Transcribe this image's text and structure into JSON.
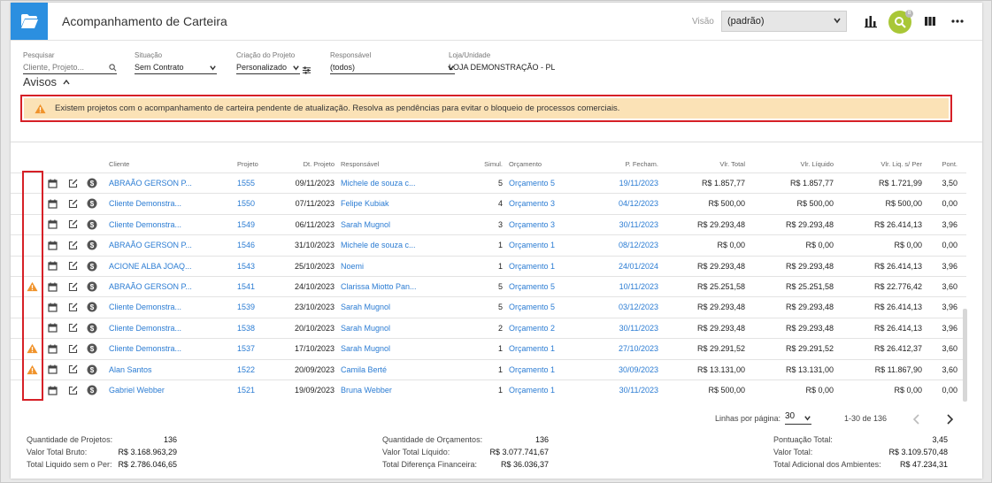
{
  "header": {
    "title": "Acompanhamento de Carteira",
    "visao_label": "Visão",
    "visao_value": "(padrão)",
    "search_badge": "8"
  },
  "filters": {
    "pesquisar": {
      "label": "Pesquisar",
      "placeholder": "Cliente, Projeto..."
    },
    "situacao": {
      "label": "Situação",
      "value": "Sem Contrato"
    },
    "criacao": {
      "label": "Criação do Projeto",
      "value": "Personalizado"
    },
    "responsavel": {
      "label": "Responsável",
      "value": "(todos)"
    },
    "loja": {
      "label": "Loja/Unidade",
      "value": "LOJA DEMONSTRAÇÃO - PL..."
    }
  },
  "avisos": {
    "title": "Avisos",
    "message": "Existem projetos com o acompanhamento de carteira pendente de atualização. Resolva as pendências para evitar o bloqueio de processos comerciais."
  },
  "table": {
    "headers": {
      "cliente": "Cliente",
      "projeto": "Projeto",
      "dt_projeto": "Dt. Projeto",
      "responsavel": "Responsável",
      "simul": "Simul.",
      "orcamento": "Orçamento",
      "p_fecham": "P. Fecham.",
      "vlr_total": "Vlr. Total",
      "vlr_liquido": "Vlr. Líquido",
      "vlr_liq_per": "Vlr. Liq. s/ Per",
      "pont": "Pont."
    },
    "rows": [
      {
        "warn": false,
        "cliente": "ABRAÃO GERSON P...",
        "projeto": "1555",
        "dt": "09/11/2023",
        "resp": "Michele de souza c...",
        "simul": "5",
        "orc": "Orçamento 5",
        "fecham": "19/11/2023",
        "total": "R$ 1.857,77",
        "liquido": "R$ 1.857,77",
        "liq_per": "R$ 1.721,99",
        "pont": "3,50"
      },
      {
        "warn": false,
        "cliente": "Cliente Demonstra...",
        "projeto": "1550",
        "dt": "07/11/2023",
        "resp": "Felipe Kubiak",
        "simul": "4",
        "orc": "Orçamento 3",
        "fecham": "04/12/2023",
        "total": "R$ 500,00",
        "liquido": "R$ 500,00",
        "liq_per": "R$ 500,00",
        "pont": "0,00"
      },
      {
        "warn": false,
        "cliente": "Cliente Demonstra...",
        "projeto": "1549",
        "dt": "06/11/2023",
        "resp": "Sarah Mugnol",
        "simul": "3",
        "orc": "Orçamento 3",
        "fecham": "30/11/2023",
        "total": "R$ 29.293,48",
        "liquido": "R$ 29.293,48",
        "liq_per": "R$ 26.414,13",
        "pont": "3,96"
      },
      {
        "warn": false,
        "cliente": "ABRAÃO GERSON P...",
        "projeto": "1546",
        "dt": "31/10/2023",
        "resp": "Michele de souza c...",
        "simul": "1",
        "orc": "Orçamento 1",
        "fecham": "08/12/2023",
        "total": "R$ 0,00",
        "liquido": "R$ 0,00",
        "liq_per": "R$ 0,00",
        "pont": "0,00"
      },
      {
        "warn": false,
        "cliente": "ACIONE ALBA JOAQ...",
        "projeto": "1543",
        "dt": "25/10/2023",
        "resp": "Noemi",
        "simul": "1",
        "orc": "Orçamento 1",
        "fecham": "24/01/2024",
        "total": "R$ 29.293,48",
        "liquido": "R$ 29.293,48",
        "liq_per": "R$ 26.414,13",
        "pont": "3,96"
      },
      {
        "warn": true,
        "cliente": "ABRAÃO GERSON P...",
        "projeto": "1541",
        "dt": "24/10/2023",
        "resp": "Clarissa Miotto Pan...",
        "simul": "5",
        "orc": "Orçamento 5",
        "fecham": "10/11/2023",
        "total": "R$ 25.251,58",
        "liquido": "R$ 25.251,58",
        "liq_per": "R$ 22.776,42",
        "pont": "3,60"
      },
      {
        "warn": false,
        "cliente": "Cliente Demonstra...",
        "projeto": "1539",
        "dt": "23/10/2023",
        "resp": "Sarah Mugnol",
        "simul": "5",
        "orc": "Orçamento 5",
        "fecham": "03/12/2023",
        "total": "R$ 29.293,48",
        "liquido": "R$ 29.293,48",
        "liq_per": "R$ 26.414,13",
        "pont": "3,96"
      },
      {
        "warn": false,
        "cliente": "Cliente Demonstra...",
        "projeto": "1538",
        "dt": "20/10/2023",
        "resp": "Sarah Mugnol",
        "simul": "2",
        "orc": "Orçamento 2",
        "fecham": "30/11/2023",
        "total": "R$ 29.293,48",
        "liquido": "R$ 29.293,48",
        "liq_per": "R$ 26.414,13",
        "pont": "3,96"
      },
      {
        "warn": true,
        "cliente": "Cliente Demonstra...",
        "projeto": "1537",
        "dt": "17/10/2023",
        "resp": "Sarah Mugnol",
        "simul": "1",
        "orc": "Orçamento 1",
        "fecham": "27/10/2023",
        "total": "R$ 29.291,52",
        "liquido": "R$ 29.291,52",
        "liq_per": "R$ 26.412,37",
        "pont": "3,60"
      },
      {
        "warn": true,
        "cliente": "Alan Santos",
        "projeto": "1522",
        "dt": "20/09/2023",
        "resp": "Camila Berté",
        "simul": "1",
        "orc": "Orçamento 1",
        "fecham": "30/09/2023",
        "total": "R$ 13.131,00",
        "liquido": "R$ 13.131,00",
        "liq_per": "R$ 11.867,90",
        "pont": "3,60"
      },
      {
        "warn": false,
        "cliente": "Gabriel Webber",
        "projeto": "1521",
        "dt": "19/09/2023",
        "resp": "Bruna Webber",
        "simul": "1",
        "orc": "Orçamento 1",
        "fecham": "30/11/2023",
        "total": "R$ 500,00",
        "liquido": "R$ 0,00",
        "liq_per": "R$ 0,00",
        "pont": "0,00"
      }
    ]
  },
  "pagination": {
    "rows_label": "Linhas por página:",
    "rows_value": "30",
    "range": "1-30 de 136"
  },
  "totals": {
    "qtd_projetos": {
      "label": "Quantidade de Projetos:",
      "value": "136"
    },
    "valor_bruto": {
      "label": "Valor Total Bruto:",
      "value": "R$ 3.168.963,29"
    },
    "liquido_sem_per": {
      "label": "Total Liquido sem o Per:",
      "value": "R$ 2.786.046,65"
    },
    "qtd_orcamentos": {
      "label": "Quantidade de Orçamentos:",
      "value": "136"
    },
    "valor_liquido": {
      "label": "Valor Total Líquido:",
      "value": "R$ 3.077.741,67"
    },
    "diferenca": {
      "label": "Total Diferença Financeira:",
      "value": "R$ 36.036,37"
    },
    "pontuacao": {
      "label": "Pontuação Total:",
      "value": "3,45"
    },
    "valor_total": {
      "label": "Valor Total:",
      "value": "R$ 3.109.570,48"
    },
    "adicional": {
      "label": "Total Adicional dos Ambientes:",
      "value": "R$ 47.234,31"
    }
  },
  "colors": {
    "brand": "#2b8fe0",
    "link": "#2b7cd3",
    "alert_bg": "#fbe2b6",
    "warn": "#f0932b",
    "search": "#a9c737",
    "highlight": "#d62027"
  }
}
